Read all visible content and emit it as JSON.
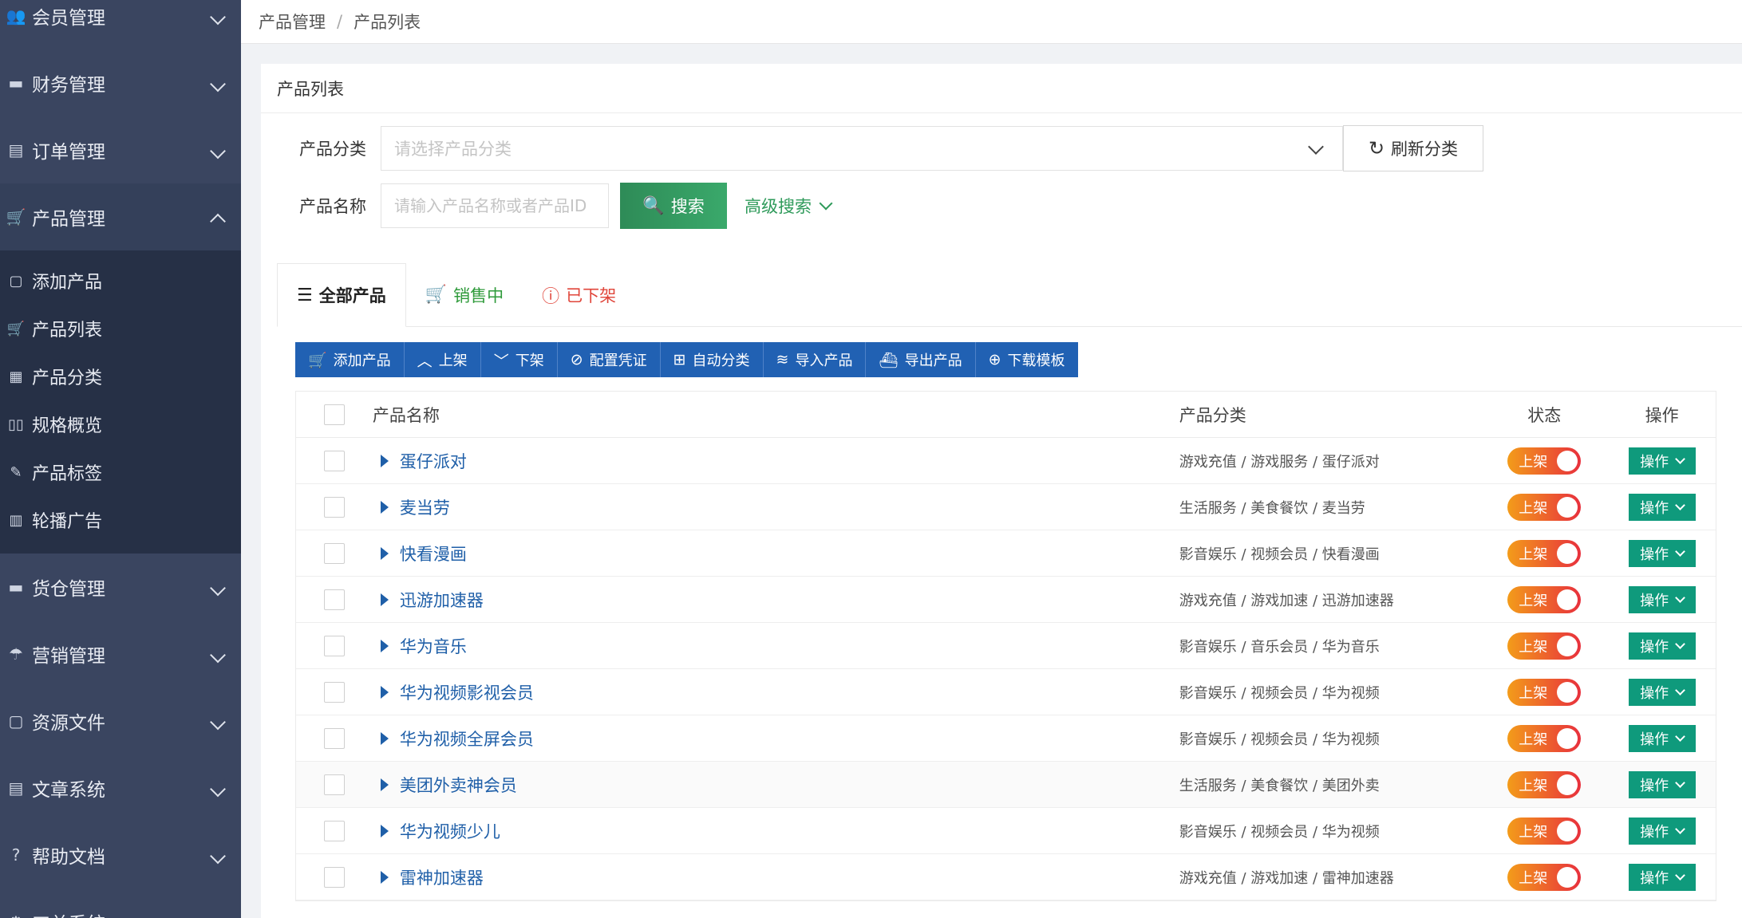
{
  "sidebar": {
    "groups_top": [
      {
        "label": "会员管理",
        "icon": "users-icon"
      },
      {
        "label": "财务管理",
        "icon": "finance-icon"
      },
      {
        "label": "订单管理",
        "icon": "order-icon"
      }
    ],
    "active_group": {
      "label": "产品管理",
      "icon": "cart-icon"
    },
    "sub_items": [
      {
        "label": "添加产品",
        "icon": "edit-icon"
      },
      {
        "label": "产品列表",
        "icon": "cart-icon"
      },
      {
        "label": "产品分类",
        "icon": "grid-icon"
      },
      {
        "label": "规格概览",
        "icon": "columns-icon"
      },
      {
        "label": "产品标签",
        "icon": "tag-icon"
      },
      {
        "label": "轮播广告",
        "icon": "carousel-icon"
      }
    ],
    "groups_bottom": [
      {
        "label": "货仓管理",
        "icon": "warehouse-icon"
      },
      {
        "label": "营销管理",
        "icon": "marketing-icon"
      },
      {
        "label": "资源文件",
        "icon": "file-icon"
      },
      {
        "label": "文章系统",
        "icon": "article-icon"
      },
      {
        "label": "帮助文档",
        "icon": "help-icon"
      },
      {
        "label": "工单系统",
        "icon": "ticket-icon"
      }
    ]
  },
  "breadcrumb": {
    "parent": "产品管理",
    "sep": "/",
    "current": "产品列表"
  },
  "card_title": "产品列表",
  "filter": {
    "category_label": "产品分类",
    "category_placeholder": "请选择产品分类",
    "refresh_label": "刷新分类",
    "name_label": "产品名称",
    "name_placeholder": "请输入产品名称或者产品ID",
    "search_label": "搜索",
    "advanced_label": "高级搜索"
  },
  "tabs": [
    {
      "label": "全部产品",
      "icon": "list-icon"
    },
    {
      "label": "销售中",
      "icon": "cart-icon"
    },
    {
      "label": "已下架",
      "icon": "info-icon"
    }
  ],
  "toolbar": [
    {
      "label": "添加产品",
      "icon": "cart-icon",
      "glyph": "🛒"
    },
    {
      "label": "上架",
      "icon": "chevron-up-icon",
      "glyph": "︿"
    },
    {
      "label": "下架",
      "icon": "chevron-down-icon",
      "glyph": "﹀"
    },
    {
      "label": "配置凭证",
      "icon": "compass-icon",
      "glyph": "⊘"
    },
    {
      "label": "自动分类",
      "icon": "apps-icon",
      "glyph": "⊞"
    },
    {
      "label": "导入产品",
      "icon": "layers-icon",
      "glyph": "≋"
    },
    {
      "label": "导出产品",
      "icon": "export-icon",
      "glyph": "⛴"
    },
    {
      "label": "下载模板",
      "icon": "download-icon",
      "glyph": "⊕"
    }
  ],
  "table": {
    "headers": {
      "name": "产品名称",
      "category": "产品分类",
      "status": "状态",
      "action": "操作"
    },
    "status_on_label": "上架",
    "action_label": "操作",
    "rows": [
      {
        "name": "蛋仔派对",
        "category": "游戏充值 / 游戏服务 / 蛋仔派对"
      },
      {
        "name": "麦当劳",
        "category": "生活服务 / 美食餐饮 / 麦当劳"
      },
      {
        "name": "快看漫画",
        "category": "影音娱乐 / 视频会员 / 快看漫画"
      },
      {
        "name": "迅游加速器",
        "category": "游戏充值 / 游戏加速 / 迅游加速器"
      },
      {
        "name": "华为音乐",
        "category": "影音娱乐 / 音乐会员 / 华为音乐"
      },
      {
        "name": "华为视频影视会员",
        "category": "影音娱乐 / 视频会员 / 华为视频"
      },
      {
        "name": "华为视频全屏会员",
        "category": "影音娱乐 / 视频会员 / 华为视频"
      },
      {
        "name": "美团外卖神会员",
        "category": "生活服务 / 美食餐饮 / 美团外卖"
      },
      {
        "name": "华为视频少儿",
        "category": "影音娱乐 / 视频会员 / 华为视频"
      },
      {
        "name": "雷神加速器",
        "category": "游戏充值 / 游戏加速 / 雷神加速器"
      }
    ]
  }
}
